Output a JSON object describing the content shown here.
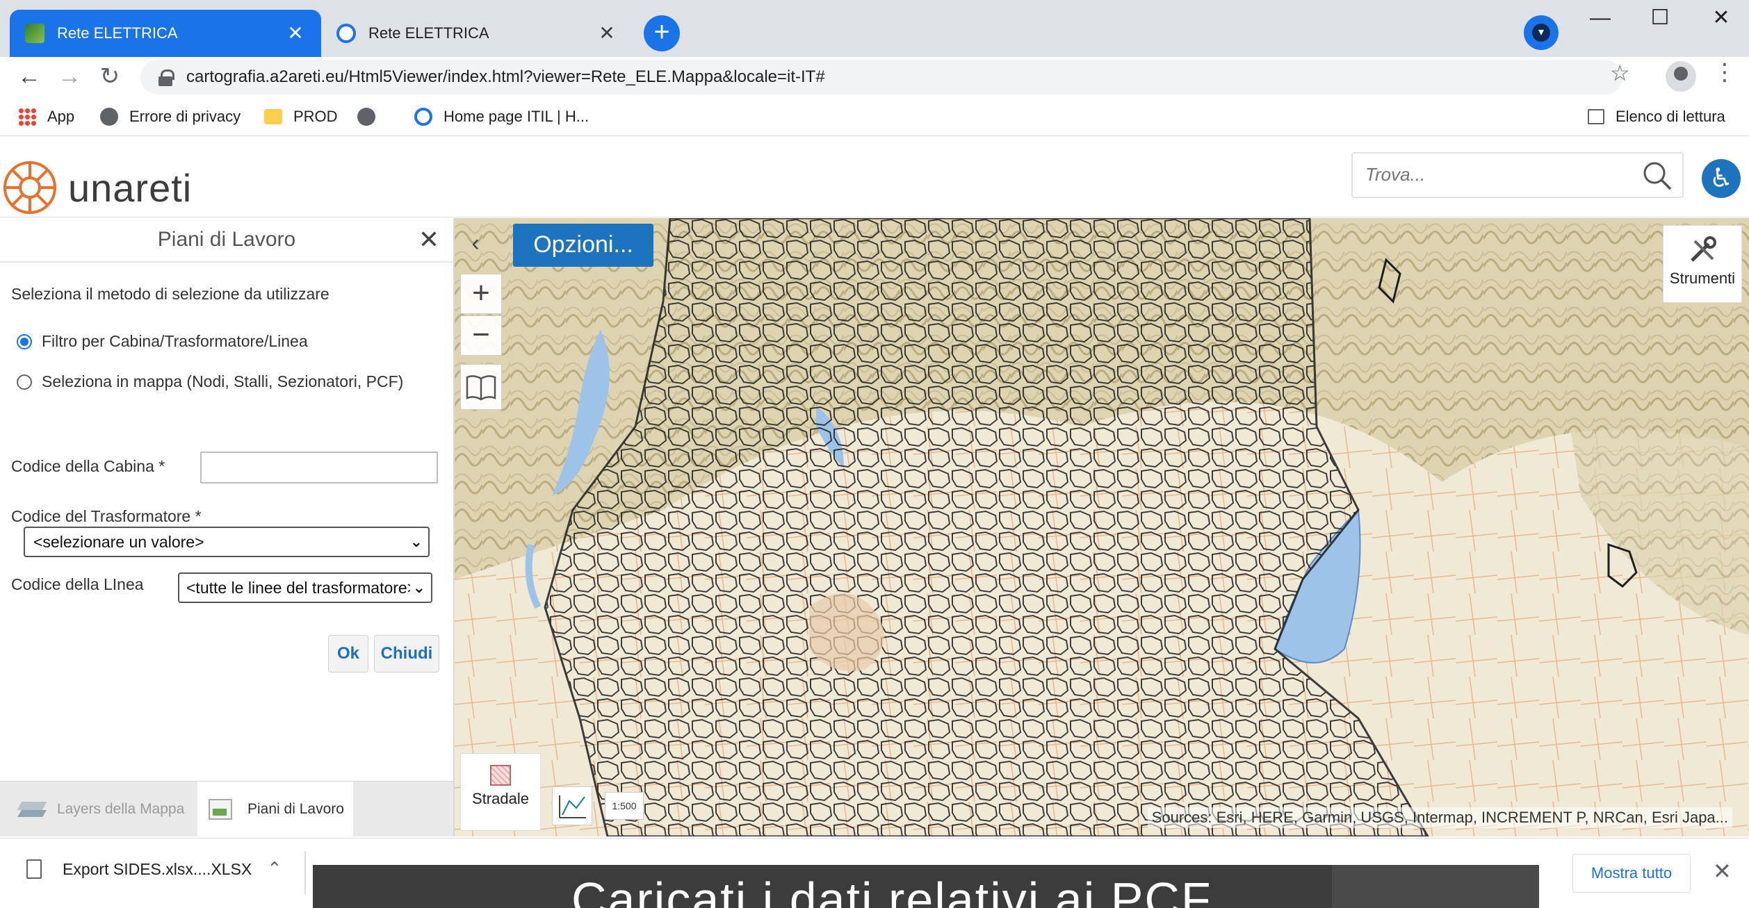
{
  "browser": {
    "tabs": [
      {
        "title": "Rete ELETTRICA",
        "active": true
      },
      {
        "title": "Rete ELETTRICA",
        "active": false
      }
    ],
    "new_tab": "+",
    "close_glyph": "✕",
    "window": {
      "minimize": "—",
      "maximize": "☐",
      "close": "✕"
    },
    "url": "cartografia.a2areti.eu/Html5Viewer/index.html?viewer=Rete_ELE.Mappa&locale=it-IT#",
    "bookmarks": [
      {
        "label": "App",
        "icon": "apps-grid-icon"
      },
      {
        "label": "Errore di privacy",
        "icon": "globe-icon"
      },
      {
        "label": "PROD",
        "icon": "folder-icon"
      },
      {
        "label": "",
        "icon": "globe-icon"
      },
      {
        "label": "Home page ITIL | H...",
        "icon": "itil-icon"
      }
    ],
    "reading_list": "Elenco di lettura"
  },
  "app": {
    "logo_text": "unareti",
    "search_placeholder": "Trova...",
    "accessibility_icon": "♿"
  },
  "panel": {
    "title": "Piani di Lavoro",
    "instruction": "Seleziona il metodo di selezione da utilizzare",
    "radio_options": [
      {
        "label": "Filtro per Cabina/Trasformatore/Linea",
        "selected": true
      },
      {
        "label": "Seleziona in mappa (Nodi, Stalli, Sezionatori, PCF)",
        "selected": false
      }
    ],
    "fields": {
      "cabina_label": "Codice della Cabina *",
      "cabina_value": "",
      "trasformatore_label": "Codice del Trasformatore *",
      "trasformatore_value": "<selezionare un valore>",
      "linea_label": "Codice della LInea",
      "linea_value": "<tutte le linee del trasformatore>"
    },
    "buttons": {
      "ok": "Ok",
      "chiudi": "Chiudi"
    },
    "bottom_tabs": [
      {
        "label": "Layers della Mappa",
        "active": false
      },
      {
        "label": "Piani di Lavoro",
        "active": true
      }
    ]
  },
  "map": {
    "options_label": "Opzioni...",
    "zoom_in": "+",
    "zoom_out": "−",
    "tools_label": "Strumenti",
    "basemap_label": "Stradale",
    "scale_tool_text": "1:500",
    "attribution": "Sources: Esri, HERE, Garmin, USGS, Intermap, INCREMENT P, NRCan, Esri Japa...",
    "colors": {
      "water": "#9ec3e8",
      "terrain": "#e6dfc4",
      "boundaries": "#1f1f1f",
      "accent": "#1e73be"
    }
  },
  "downloads": {
    "file": "Export SIDES.xlsx....XLSX",
    "overlay_text": "Caricati i dati relativi ai PCF",
    "show_all": "Mostra tutto"
  }
}
